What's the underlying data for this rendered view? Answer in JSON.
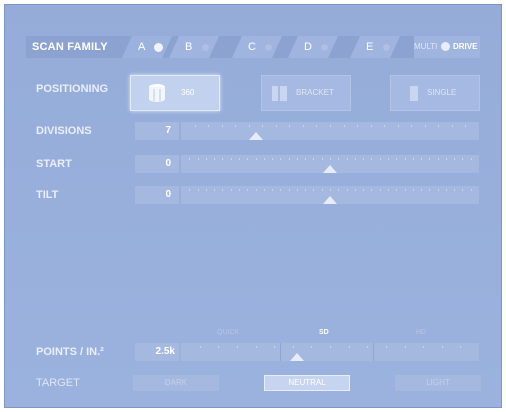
{
  "header": {
    "title": "SCAN FAMILY",
    "families": [
      {
        "label": "A",
        "active": true
      },
      {
        "label": "B",
        "active": false
      },
      {
        "label": "C",
        "active": false
      },
      {
        "label": "D",
        "active": false
      },
      {
        "label": "E",
        "active": false
      }
    ],
    "multi_label": "MULTI",
    "drive_label": "DRIVE"
  },
  "positioning": {
    "label": "POSITIONING",
    "options": [
      {
        "label": "360",
        "icon": "cylinder-360-icon",
        "active": true
      },
      {
        "label": "BRACKET",
        "icon": "bracket-icon",
        "active": false
      },
      {
        "label": "SINGLE",
        "icon": "single-panel-icon",
        "active": false
      }
    ]
  },
  "divisions": {
    "label": "DIVISIONS",
    "value": "7",
    "position": 0.25
  },
  "start": {
    "label": "START",
    "value": "0",
    "position": 0.5
  },
  "tilt": {
    "label": "TILT",
    "value": "0",
    "position": 0.5
  },
  "points": {
    "label": "POINTS / IN.²",
    "value": "2.5k",
    "quality_levels": [
      "QUICK",
      "SD",
      "HD"
    ],
    "active_quality": "SD",
    "position": 0.39
  },
  "target": {
    "label": "TARGET",
    "options": [
      {
        "label": "DARK",
        "active": false
      },
      {
        "label": "NEUTRAL",
        "active": true
      },
      {
        "label": "LIGHT",
        "active": false
      }
    ]
  },
  "colors": {
    "panel": "#95acd9",
    "highlight": "#e6edf9"
  }
}
